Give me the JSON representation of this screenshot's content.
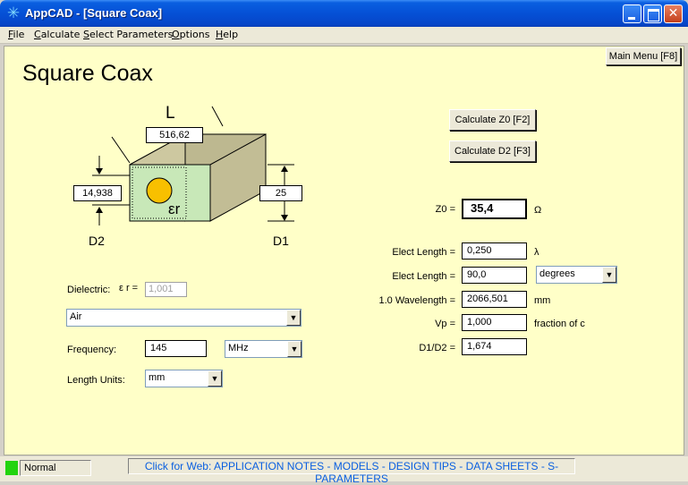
{
  "window": {
    "title": "AppCAD - [Square Coax]",
    "controls": {
      "minimize": "",
      "maximize": "",
      "close": "✕"
    }
  },
  "menu": [
    {
      "label": "File"
    },
    {
      "label": "Calculate"
    },
    {
      "label": "Select Parameters"
    },
    {
      "label": "Options"
    },
    {
      "label": "Help"
    }
  ],
  "main": {
    "main_menu_label": "Main Menu [F8]",
    "page_title": "Square Coax",
    "calc_z0_label": "Calculate Z0  [F2]",
    "calc_d2_label": "Calculate D2  [F3]"
  },
  "diagram": {
    "L_label": "L",
    "L_value": "516,62",
    "D2_value": "14,938",
    "D1_value": "25",
    "D2_label": "D2",
    "D1_label": "D1",
    "er_symbol": "εr",
    "colors": {
      "box_face": "#c8e8b8",
      "box_top": "#cdc8a0",
      "box_side": "#bdb890",
      "center": "#f8c000"
    }
  },
  "inputs": {
    "dielectric_label": "Dielectric:",
    "er_label": "ε r =",
    "er_value": "1,001",
    "dielectric_selected": "Air",
    "frequency_label": "Frequency:",
    "frequency_value": "145",
    "frequency_unit": "MHz",
    "length_units_label": "Length Units:",
    "length_units_value": "mm"
  },
  "results": {
    "z0_label": "Z0 =",
    "z0_value": "35,4",
    "z0_unit": "Ω",
    "elect_len1_label": "Elect Length =",
    "elect_len1_value": "0,250",
    "elect_len1_unit": "λ",
    "elect_len2_label": "Elect Length =",
    "elect_len2_value": "90,0",
    "elect_len2_unit": "degrees",
    "wavelength_label": "1.0 Wavelength =",
    "wavelength_value": "2066,501",
    "wavelength_unit": "mm",
    "vp_label": "Vp =",
    "vp_value": "1,000",
    "vp_unit": "fraction of c",
    "ratio_label": "D1/D2 =",
    "ratio_value": "1,674"
  },
  "status": {
    "text": "Normal",
    "web_link": "Click for Web: APPLICATION NOTES - MODELS - DESIGN TIPS - DATA SHEETS - S-PARAMETERS",
    "led_color": "#22d40e"
  }
}
